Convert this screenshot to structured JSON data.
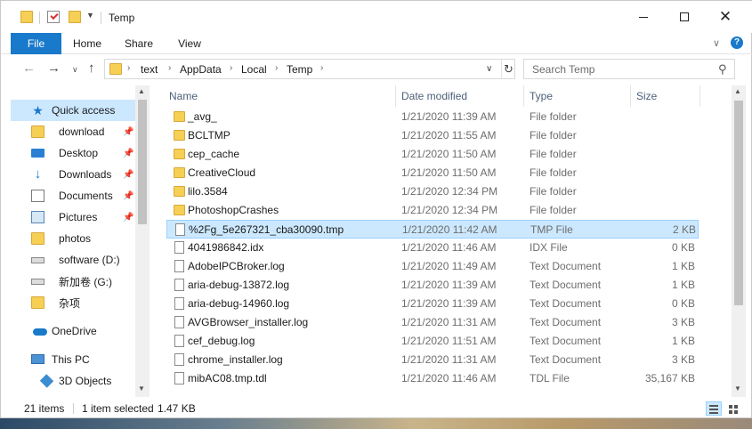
{
  "window": {
    "title": "Temp"
  },
  "ribbon": {
    "tabs": [
      "File",
      "Home",
      "Share",
      "View"
    ],
    "help": "?"
  },
  "address": {
    "crumbs": [
      "text",
      "AppData",
      "Local",
      "Temp"
    ]
  },
  "search": {
    "placeholder": "Search Temp"
  },
  "nav": {
    "items": [
      {
        "label": "Quick access",
        "icon": "star-icon",
        "pinned": false
      },
      {
        "label": "download",
        "icon": "folder-icon",
        "pinned": true
      },
      {
        "label": "Desktop",
        "icon": "desktop-icon",
        "pinned": true
      },
      {
        "label": "Downloads",
        "icon": "download-arrow-icon",
        "pinned": true
      },
      {
        "label": "Documents",
        "icon": "documents-icon",
        "pinned": true
      },
      {
        "label": "Pictures",
        "icon": "pictures-icon",
        "pinned": true
      },
      {
        "label": "photos",
        "icon": "folder-icon",
        "pinned": false
      },
      {
        "label": "software (D:)",
        "icon": "drive-icon",
        "pinned": false
      },
      {
        "label": "新加卷 (G:)",
        "icon": "drive-icon",
        "pinned": false
      },
      {
        "label": "杂项",
        "icon": "folder-icon",
        "pinned": false
      },
      {
        "label": "OneDrive",
        "icon": "cloud-icon",
        "pinned": false
      },
      {
        "label": "This PC",
        "icon": "computer-icon",
        "pinned": false
      },
      {
        "label": "3D Objects",
        "icon": "3d-objects-icon",
        "pinned": false
      }
    ]
  },
  "list": {
    "columns": {
      "name": "Name",
      "date": "Date modified",
      "type": "Type",
      "size": "Size"
    },
    "files": [
      {
        "name": "_avg_",
        "date": "1/21/2020 11:39 AM",
        "type": "File folder",
        "size": "",
        "kind": "folder"
      },
      {
        "name": "BCLTMP",
        "date": "1/21/2020 11:55 AM",
        "type": "File folder",
        "size": "",
        "kind": "folder"
      },
      {
        "name": "cep_cache",
        "date": "1/21/2020 11:50 AM",
        "type": "File folder",
        "size": "",
        "kind": "folder"
      },
      {
        "name": "CreativeCloud",
        "date": "1/21/2020 11:50 AM",
        "type": "File folder",
        "size": "",
        "kind": "folder"
      },
      {
        "name": "lilo.3584",
        "date": "1/21/2020 12:34 PM",
        "type": "File folder",
        "size": "",
        "kind": "folder"
      },
      {
        "name": "PhotoshopCrashes",
        "date": "1/21/2020 12:34 PM",
        "type": "File folder",
        "size": "",
        "kind": "folder"
      },
      {
        "name": "%2Fg_5e267321_cba30090.tmp",
        "date": "1/21/2020 11:42 AM",
        "type": "TMP File",
        "size": "2 KB",
        "kind": "file",
        "selected": true
      },
      {
        "name": "4041986842.idx",
        "date": "1/21/2020 11:46 AM",
        "type": "IDX File",
        "size": "0 KB",
        "kind": "file"
      },
      {
        "name": "AdobeIPCBroker.log",
        "date": "1/21/2020 11:49 AM",
        "type": "Text Document",
        "size": "1 KB",
        "kind": "file"
      },
      {
        "name": "aria-debug-13872.log",
        "date": "1/21/2020 11:39 AM",
        "type": "Text Document",
        "size": "1 KB",
        "kind": "file"
      },
      {
        "name": "aria-debug-14960.log",
        "date": "1/21/2020 11:39 AM",
        "type": "Text Document",
        "size": "0 KB",
        "kind": "file"
      },
      {
        "name": "AVGBrowser_installer.log",
        "date": "1/21/2020 11:31 AM",
        "type": "Text Document",
        "size": "3 KB",
        "kind": "file"
      },
      {
        "name": "cef_debug.log",
        "date": "1/21/2020 11:51 AM",
        "type": "Text Document",
        "size": "1 KB",
        "kind": "file"
      },
      {
        "name": "chrome_installer.log",
        "date": "1/21/2020 11:31 AM",
        "type": "Text Document",
        "size": "3 KB",
        "kind": "file"
      },
      {
        "name": "mibAC08.tmp.tdl",
        "date": "1/21/2020 11:46 AM",
        "type": "TDL File",
        "size": "35,167 KB",
        "kind": "file"
      }
    ]
  },
  "status": {
    "count": "21 items",
    "selection": "1 item selected",
    "size": "1.47 KB"
  },
  "colors": {
    "accent": "#1979ca",
    "selection": "#cce8ff",
    "folder": "#f6cf55"
  }
}
